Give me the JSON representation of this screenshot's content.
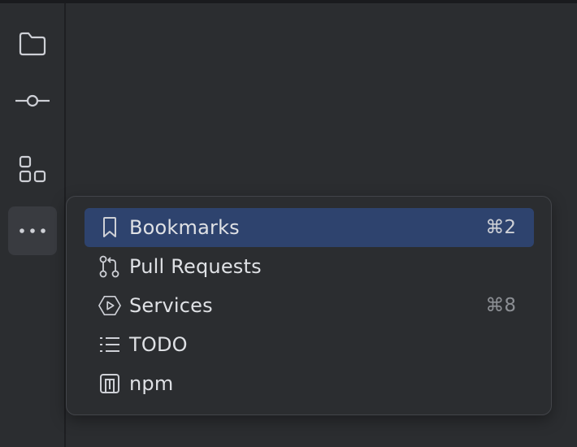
{
  "toolstrip": {
    "buttons": [
      {
        "icon": "folder-icon"
      },
      {
        "icon": "commit-icon"
      },
      {
        "icon": "structure-icon"
      },
      {
        "icon": "more-icon",
        "active": true
      }
    ]
  },
  "popup": {
    "items": [
      {
        "label": "Bookmarks",
        "shortcut": "⌘2",
        "icon": "bookmark-icon",
        "selected": true
      },
      {
        "label": "Pull Requests",
        "shortcut": "",
        "icon": "pull-request-icon"
      },
      {
        "label": "Services",
        "shortcut": "⌘8",
        "icon": "services-icon"
      },
      {
        "label": "TODO",
        "shortcut": "",
        "icon": "todo-list-icon"
      },
      {
        "label": "npm",
        "shortcut": "",
        "icon": "npm-icon"
      }
    ]
  },
  "colors": {
    "background": "#2b2d30",
    "selected": "#2e436e",
    "text": "#dfe1e5",
    "shortcut": "#8c8f94"
  }
}
